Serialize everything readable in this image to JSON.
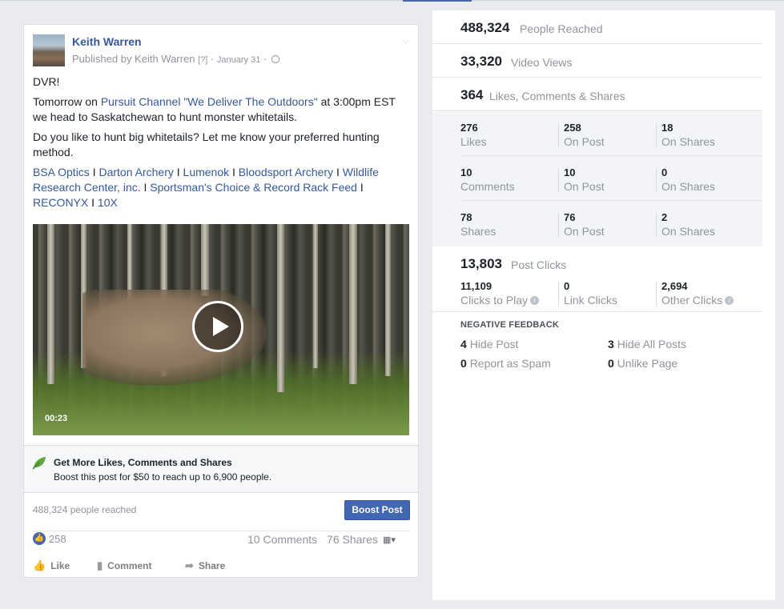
{
  "post": {
    "author": "Keith Warren",
    "published_by": "Published by Keith Warren",
    "help_mark": "[?]",
    "separator": "·",
    "date": "January 31",
    "text": {
      "line1": "DVR!",
      "tomorrow_prefix": "Tomorrow on ",
      "channel_link": "Pursuit Channel \"We Deliver The Outdoors\"",
      "tomorrow_suffix": " at 3:00pm EST we head to Saskatchewan to hunt monster whitetails.",
      "question": "Do you like to hunt big whitetails? Let me know your preferred hunting method.",
      "sponsors": [
        "BSA Optics",
        "Darton Archery",
        "Lumenok",
        "Bloodsport Archery",
        "Wildlife Research Center, inc.",
        "Sportsman's Choice & Record Rack Feed",
        "RECONYX",
        "10X"
      ],
      "sponsor_sep": " I "
    },
    "video_duration": "00:23",
    "boost_title": "Get More Likes, Comments and Shares",
    "boost_desc": "Boost this post for $50 to reach up to 6,900 people.",
    "reached": "488,324 people reached",
    "boost_button": "Boost Post",
    "like_count": "258",
    "comments": "10 Comments",
    "shares": "76 Shares",
    "actions": {
      "like": "Like",
      "comment": "Comment",
      "share": "Share"
    }
  },
  "insights": {
    "people_reached": {
      "value": "488,324",
      "label": "People Reached"
    },
    "video_views": {
      "value": "33,320",
      "label": "Video Views"
    },
    "engagement": {
      "value": "364",
      "label": "Likes, Comments & Shares"
    },
    "grid": [
      [
        {
          "value": "276",
          "label": "Likes"
        },
        {
          "value": "258",
          "label": "On Post"
        },
        {
          "value": "18",
          "label": "On Shares"
        }
      ],
      [
        {
          "value": "10",
          "label": "Comments"
        },
        {
          "value": "10",
          "label": "On Post"
        },
        {
          "value": "0",
          "label": "On Shares"
        }
      ],
      [
        {
          "value": "78",
          "label": "Shares"
        },
        {
          "value": "76",
          "label": "On Post"
        },
        {
          "value": "2",
          "label": "On Shares"
        }
      ]
    ],
    "post_clicks": {
      "value": "13,803",
      "label": "Post Clicks"
    },
    "clicks": [
      {
        "value": "11,109",
        "label": "Clicks to Play"
      },
      {
        "value": "0",
        "label": "Link Clicks"
      },
      {
        "value": "2,694",
        "label": "Other Clicks"
      }
    ],
    "negative_title": "NEGATIVE FEEDBACK",
    "negative": [
      {
        "value": "4",
        "label": "Hide Post"
      },
      {
        "value": "3",
        "label": "Hide All Posts"
      },
      {
        "value": "0",
        "label": "Report as Spam"
      },
      {
        "value": "0",
        "label": "Unlike Page"
      }
    ],
    "info_mark": "i"
  }
}
